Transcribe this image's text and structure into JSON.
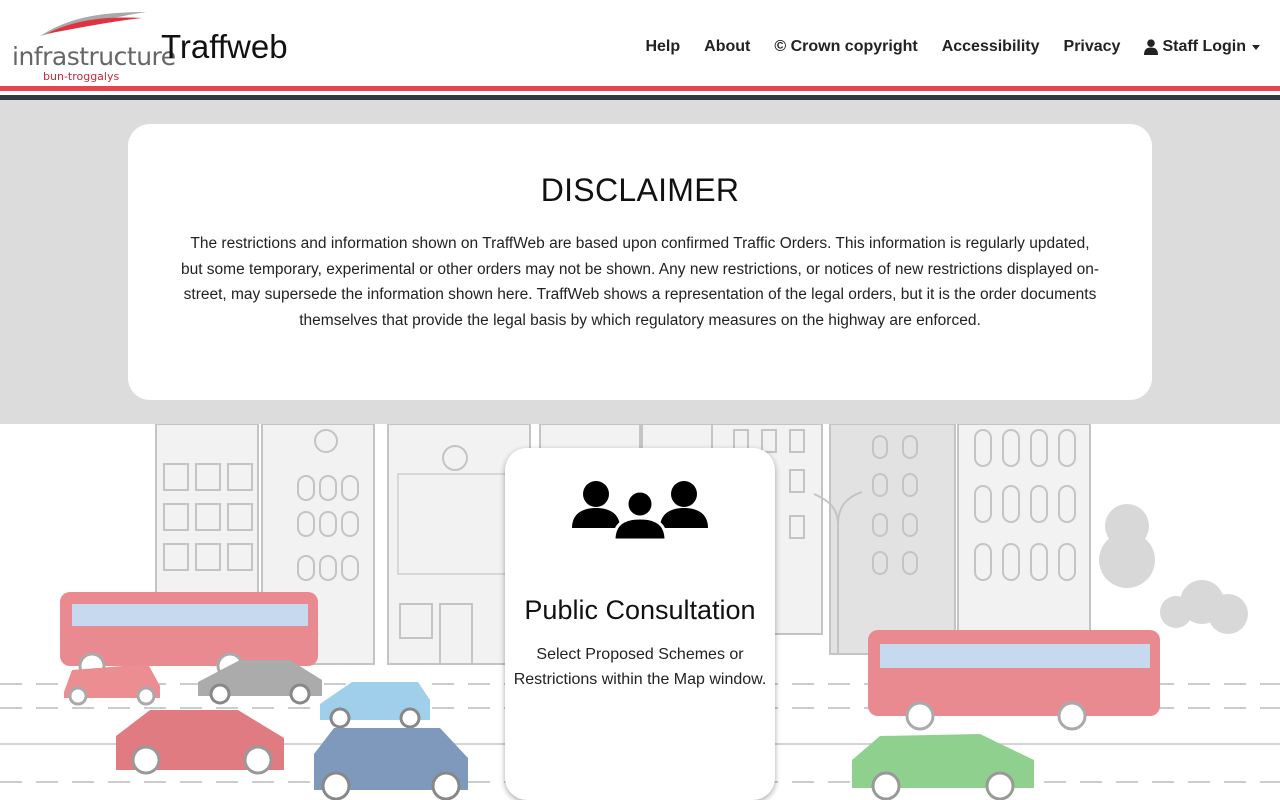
{
  "header": {
    "logo_word": "infrastructure",
    "logo_sub": "bun-troggalys",
    "app_title": "Traffweb",
    "nav": {
      "help": "Help",
      "about": "About",
      "copyright": "© Crown copyright",
      "accessibility": "Accessibility",
      "privacy": "Privacy",
      "staff_login": "Staff Login"
    }
  },
  "disclaimer": {
    "title": "DISCLAIMER",
    "text": "The restrictions and information shown on TraffWeb are based upon confirmed Traffic Orders. This information is regularly updated, but some temporary, experimental or other orders may not be shown. Any new restrictions, or notices of new restrictions displayed on-street, may supersede the information shown here. TraffWeb shows a representation of the legal orders, but it is the order documents themselves that provide the legal basis by which regulatory measures on the highway are enforced."
  },
  "consultation": {
    "icon": "users-icon",
    "title": "Public Consultation",
    "text": "Select Proposed Schemes or Restrictions within the Map window."
  },
  "colors": {
    "accent_red": "#e8424b",
    "dark_stripe": "#333940",
    "band_grey": "#dcdcdc"
  }
}
